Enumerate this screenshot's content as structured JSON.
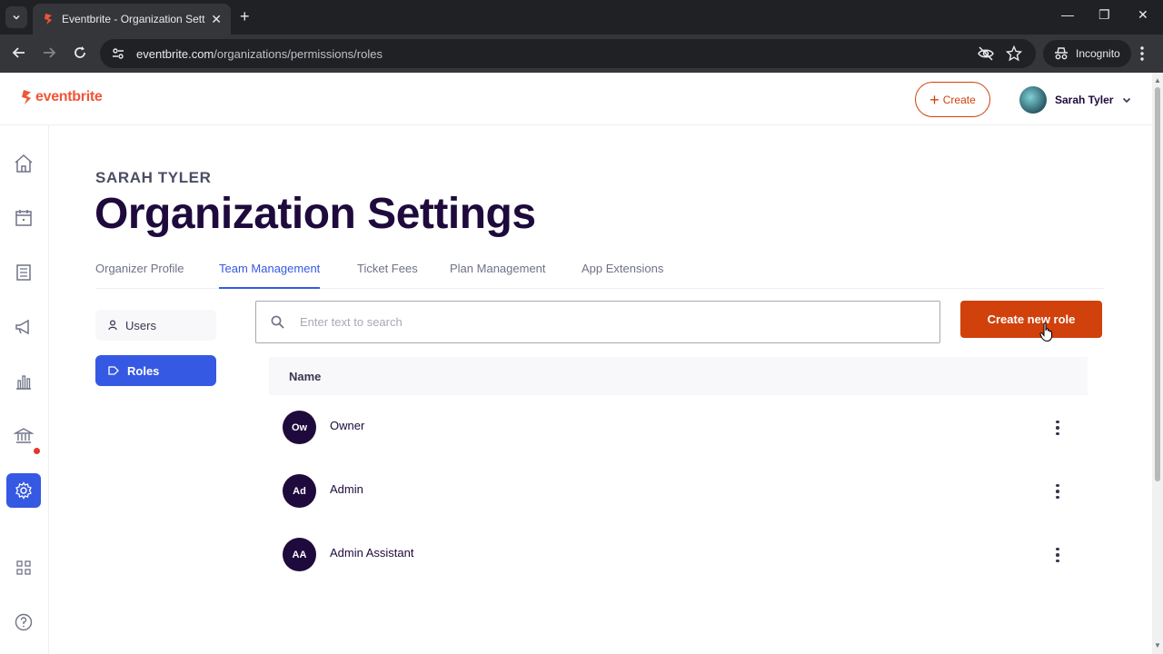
{
  "browser": {
    "tab_title": "Eventbrite - Organization Settings",
    "url_domain": "eventbrite.com",
    "url_path": "/organizations/permissions/roles",
    "incognito_label": "Incognito",
    "new_tab_symbol": "+",
    "close_tab_symbol": "✕",
    "minimize_symbol": "—",
    "restore_symbol": "❐",
    "close_window_symbol": "✕"
  },
  "header": {
    "logo_text": "eventbrite",
    "create_label": "Create",
    "user_name": "Sarah Tyler"
  },
  "sidebar": {
    "items": [
      {
        "icon": "home-icon"
      },
      {
        "icon": "calendar-icon"
      },
      {
        "icon": "orders-icon"
      },
      {
        "icon": "megaphone-icon"
      },
      {
        "icon": "reports-icon"
      },
      {
        "icon": "finance-icon"
      },
      {
        "icon": "settings-icon",
        "active": true
      },
      {
        "icon": "apps-icon"
      },
      {
        "icon": "help-icon"
      }
    ]
  },
  "main": {
    "owner": "SARAH TYLER",
    "title": "Organization Settings",
    "tabs": [
      {
        "label": "Organizer Profile"
      },
      {
        "label": "Team Management",
        "active": true
      },
      {
        "label": "Ticket Fees"
      },
      {
        "label": "Plan Management"
      },
      {
        "label": "App Extensions"
      }
    ],
    "subnav": {
      "users": "Users",
      "roles": "Roles"
    },
    "search": {
      "placeholder": "Enter text to search",
      "value": ""
    },
    "create_role_label": "Create new role",
    "table": {
      "header": "Name",
      "rows": [
        {
          "initials": "Ow",
          "name": "Owner"
        },
        {
          "initials": "Ad",
          "name": "Admin"
        },
        {
          "initials": "AA",
          "name": "Admin Assistant"
        }
      ]
    }
  },
  "colors": {
    "brand_orange": "#f05537",
    "primary_button": "#d1410c",
    "active_blue": "#3659e3",
    "dark_purple": "#1e0a3c"
  }
}
